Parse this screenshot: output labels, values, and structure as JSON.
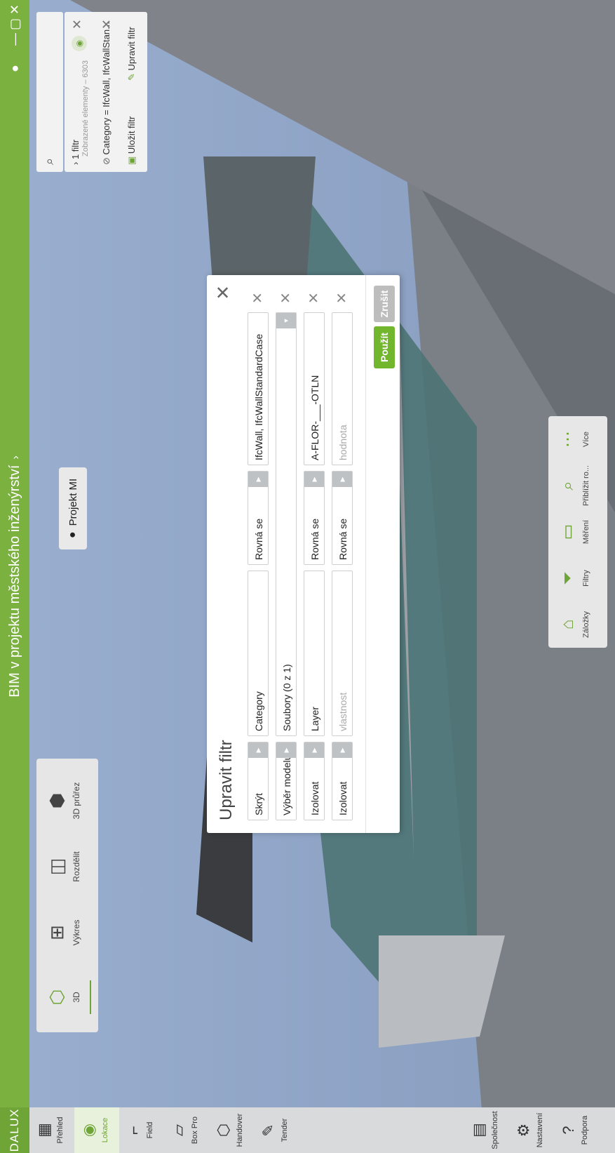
{
  "app": {
    "logo": "DALUX",
    "title": "BIM v projektu městského inženýrství",
    "title_chevron": "›"
  },
  "topbar_icons": {
    "account": "account-icon",
    "minimize": "—",
    "maximize": "▢",
    "close": "✕"
  },
  "nav": {
    "items": [
      {
        "label": "Přehled",
        "icon": "▦"
      },
      {
        "label": "Lokace",
        "icon": "◉"
      },
      {
        "label": "Field",
        "icon": "⌐"
      },
      {
        "label": "Box Pro",
        "icon": "▱"
      },
      {
        "label": "Handover",
        "icon": "⬡"
      },
      {
        "label": "Tender",
        "icon": "✎"
      }
    ],
    "bottom": [
      {
        "label": "Společnost",
        "icon": "▤"
      },
      {
        "label": "Nastavení",
        "icon": "⚙"
      },
      {
        "label": "Podpora",
        "icon": "?"
      }
    ]
  },
  "view_tools": [
    {
      "label": "3D",
      "icon": "⬡"
    },
    {
      "label": "Výkres",
      "icon": "⊞"
    },
    {
      "label": "Rozdělit",
      "icon": "◫"
    },
    {
      "label": "3D průřez",
      "icon": "⬢"
    }
  ],
  "project_chip": {
    "label": "Projekt MI",
    "icon": "●"
  },
  "filter_panel": {
    "search_icon": "⌕",
    "summary": "1 filtr",
    "summary_sub": "Zobrazené elementy – 6303",
    "filter_text": "Category = IfcWall, IfcWallStan...",
    "save_label": "Uložit filtr",
    "edit_label": "Upravit filtr"
  },
  "dialog": {
    "title": "Upravit filtr",
    "rows": [
      {
        "action": "Skrýt",
        "property": "Category",
        "operator": "Rovná se",
        "value": "IfcWall, IfcWallStandardCase",
        "value_placeholder": false
      },
      {
        "action": "Výběr modelu",
        "property": "Soubory (0 z 1)",
        "operator": "",
        "value": "",
        "value_placeholder": false
      },
      {
        "action": "Izolovat",
        "property": "Layer",
        "operator": "Rovná se",
        "value": "A-FLOR-___-OTLN",
        "value_placeholder": false
      },
      {
        "action": "Izolovat",
        "property": "vlastnost",
        "operator": "Rovná se",
        "value": "hodnota",
        "value_placeholder": true
      }
    ],
    "apply_label": "Použít",
    "cancel_label": "Zrušit"
  },
  "bottom_tools": [
    {
      "label": "Záložky",
      "icon": "⌂"
    },
    {
      "label": "Filtry",
      "icon": "⏷"
    },
    {
      "label": "Měření",
      "icon": "▭"
    },
    {
      "label": "Přiblížit ro...",
      "icon": "⌕"
    },
    {
      "label": "Více",
      "icon": "⋯"
    }
  ],
  "colors": {
    "accent": "#7bb13f",
    "apply": "#72b62d",
    "cancel": "#bdbdbd"
  }
}
